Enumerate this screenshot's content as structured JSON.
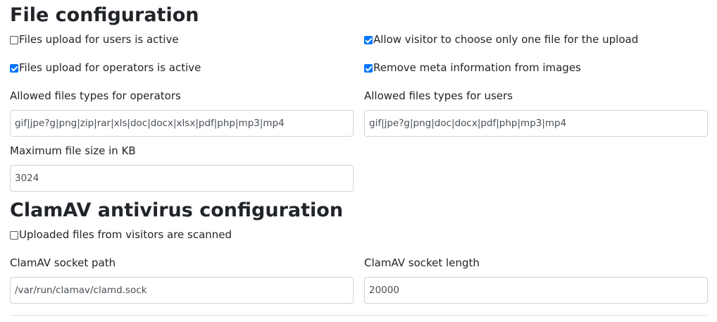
{
  "file_config": {
    "heading": "File configuration",
    "users_upload_active": {
      "label": "Files upload for users is active",
      "checked": false
    },
    "operators_upload_active": {
      "label": "Files upload for operators is active",
      "checked": true
    },
    "one_file_only": {
      "label": "Allow visitor to choose only one file for the upload",
      "checked": true
    },
    "remove_meta": {
      "label": "Remove meta information from images",
      "checked": true
    },
    "operators_types_label": "Allowed files types for operators",
    "operators_types_value": "gif|jpe?g|png|zip|rar|xls|doc|docx|xlsx|pdf|php|mp3|mp4",
    "users_types_label": "Allowed files types for users",
    "users_types_value": "gif|jpe?g|png|doc|docx|pdf|php|mp3|mp4",
    "max_size_label": "Maximum file size in KB",
    "max_size_value": "3024"
  },
  "clamav": {
    "heading": "ClamAV antivirus configuration",
    "scan_uploads": {
      "label": "Uploaded files from visitors are scanned",
      "checked": false
    },
    "socket_path_label": "ClamAV socket path",
    "socket_path_value": "/var/run/clamav/clamd.sock",
    "socket_length_label": "ClamAV socket length",
    "socket_length_value": "20000"
  },
  "colors": {
    "checkbox_accent": "#0075ff",
    "input_border": "#ced4da",
    "text": "#212529"
  }
}
